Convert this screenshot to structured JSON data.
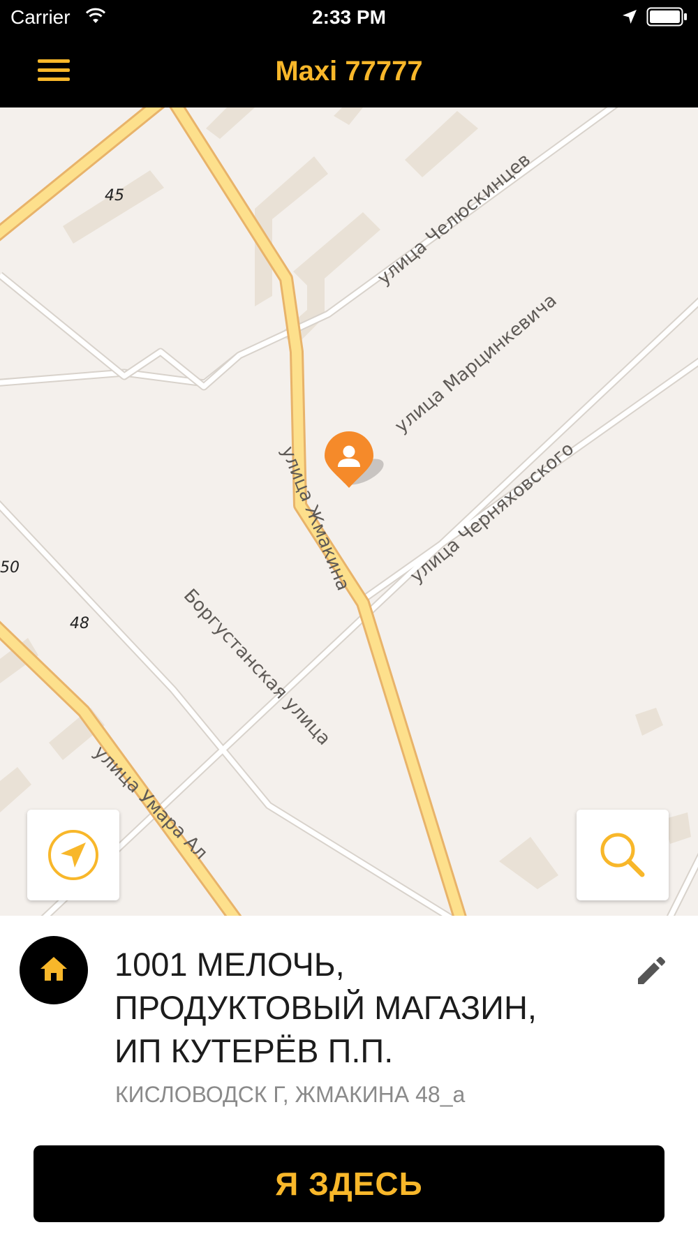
{
  "status_bar": {
    "carrier": "Carrier",
    "time": "2:33 PM",
    "icons": [
      "wifi-icon",
      "location-arrow-icon",
      "battery-icon"
    ]
  },
  "nav_bar": {
    "title": "Maxi 77777",
    "menu_icon": "hamburger-menu-icon"
  },
  "map": {
    "streets": {
      "chelyuskintsev": "улица Челюскинцев",
      "martsinkevicha": "улица Марцинкевича",
      "zhmakina": "улица Жмакина",
      "chernyakhovskogo": "улица Черняховского",
      "borgustanskaya": "Боргустанская улица",
      "umara": "улица Умара Ал"
    },
    "house_numbers": {
      "n45": "45",
      "n50": "50",
      "n48": "48"
    },
    "pin_icon": "user-location-pin-icon",
    "locate_button_icon": "navigation-arrow-icon",
    "search_button_icon": "search-icon"
  },
  "place": {
    "icon": "home-icon",
    "name": "1001 МЕЛОЧЬ,\nПРОДУКТОВЫЙ МАГАЗИН,\nИП КУТЕРЁВ П.П.",
    "address": "КИСЛОВОДСК Г, ЖМАКИНА 48_а",
    "edit_icon": "pencil-icon"
  },
  "confirm_button": {
    "label": "Я ЗДЕСЬ"
  },
  "colors": {
    "accent": "#f8b72a",
    "bar_background": "#000000",
    "map_background": "#f4f0ec",
    "major_road": "#fde08c",
    "pin": "#f58a2a"
  }
}
